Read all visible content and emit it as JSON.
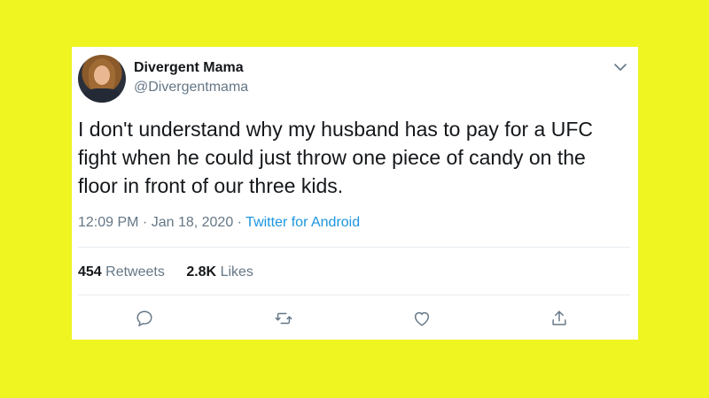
{
  "tweet": {
    "author_name": "Divergent Mama",
    "author_handle": "@Divergentmama",
    "text": "I don't understand why my husband has to pay for a UFC\nfight when he could just throw one piece of candy on the\nfloor in front of our three kids.",
    "time": "12:09 PM",
    "separator": " · ",
    "date": "Jan 18, 2020",
    "source": "Twitter for Android",
    "retweets_count": "454",
    "retweets_label": "Retweets",
    "likes_count": "2.8K",
    "likes_label": "Likes"
  },
  "icons": {
    "menu": "chevron-down-icon",
    "reply": "reply-icon",
    "retweet": "retweet-icon",
    "like": "heart-icon",
    "share": "share-icon"
  },
  "colors": {
    "background": "#eef520",
    "card": "#ffffff",
    "text": "#14171a",
    "secondary": "#657786",
    "link": "#1b95e0",
    "divider": "#e6ecf0"
  }
}
